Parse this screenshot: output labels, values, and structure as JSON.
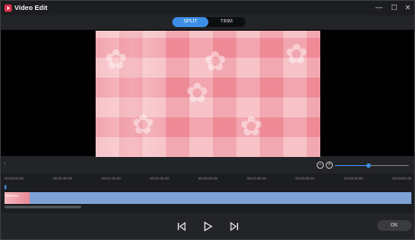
{
  "window": {
    "title": "Video Edit",
    "minimize": "—",
    "maximize": "☐",
    "close": "✕"
  },
  "mode_toggle": {
    "split": "SPLIT",
    "trim": "TRIM",
    "active": "SPLIT"
  },
  "colors": {
    "accent": "#3d8ee6",
    "background": "#232427",
    "track": "#7ea2d6",
    "app_icon": "#e3304b"
  },
  "zoom": {
    "level": 0.46
  },
  "timeline": {
    "ticks": [
      "00:00:00.00",
      "00:00:30.00",
      "00:01:00.00",
      "00:01:30.00",
      "00:02:00.00",
      "00:02:30.00",
      "00:03:00.00",
      "00:03:30.00",
      "00:04:00.00"
    ],
    "clip_label": "Windows"
  },
  "transport": {
    "ok": "OK"
  },
  "icons": {
    "app": "video-edit-app-icon",
    "prev_frame": "skip-previous-icon",
    "play": "play-icon",
    "next_frame": "skip-next-icon",
    "zoom_out": "zoom-out-icon",
    "zoom_in": "zoom-in-icon"
  }
}
